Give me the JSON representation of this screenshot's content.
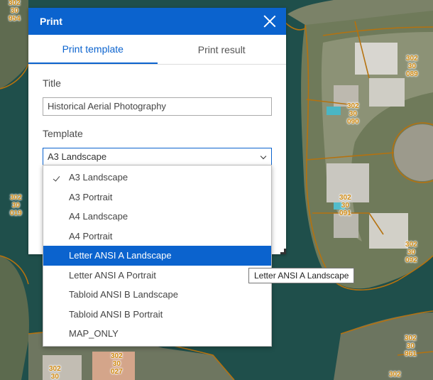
{
  "panel": {
    "title": "Print",
    "tabs": [
      {
        "label": "Print template",
        "active": true
      },
      {
        "label": "Print result",
        "active": false
      }
    ],
    "title_field": {
      "label": "Title",
      "value": "Historical Aerial Photography"
    },
    "template_field": {
      "label": "Template",
      "value": "A3 Landscape"
    }
  },
  "dropdown": {
    "options": [
      {
        "label": "A3 Landscape",
        "checked": true
      },
      {
        "label": "A3 Portrait"
      },
      {
        "label": "A4 Landscape"
      },
      {
        "label": "A4 Portrait"
      },
      {
        "label": "Letter ANSI A Landscape",
        "highlighted": true
      },
      {
        "label": "Letter ANSI A Portrait"
      },
      {
        "label": "Tabloid ANSI B Landscape"
      },
      {
        "label": "Tabloid ANSI B Portrait"
      },
      {
        "label": "MAP_ONLY"
      }
    ]
  },
  "tooltip": "Letter ANSI A Landscape",
  "map": {
    "parcel_labels": [
      {
        "lines": [
          "302",
          "30",
          "954"
        ]
      },
      {
        "lines": [
          "302",
          "30",
          "089"
        ]
      },
      {
        "lines": [
          "302",
          "30",
          "090"
        ]
      },
      {
        "lines": [
          "302",
          "30",
          "019"
        ]
      },
      {
        "lines": [
          "302",
          "30",
          "091"
        ]
      },
      {
        "lines": [
          "302",
          "30",
          "092"
        ]
      },
      {
        "lines": [
          "302",
          "30",
          "961"
        ]
      },
      {
        "lines": [
          "302",
          "30",
          "027"
        ]
      },
      {
        "lines": [
          "302",
          "30"
        ]
      },
      {
        "lines": [
          "302"
        ]
      }
    ]
  },
  "colors": {
    "accent": "#0b63ce",
    "parcel_label": "#d08a12",
    "parcel_line": "#b5720f"
  }
}
